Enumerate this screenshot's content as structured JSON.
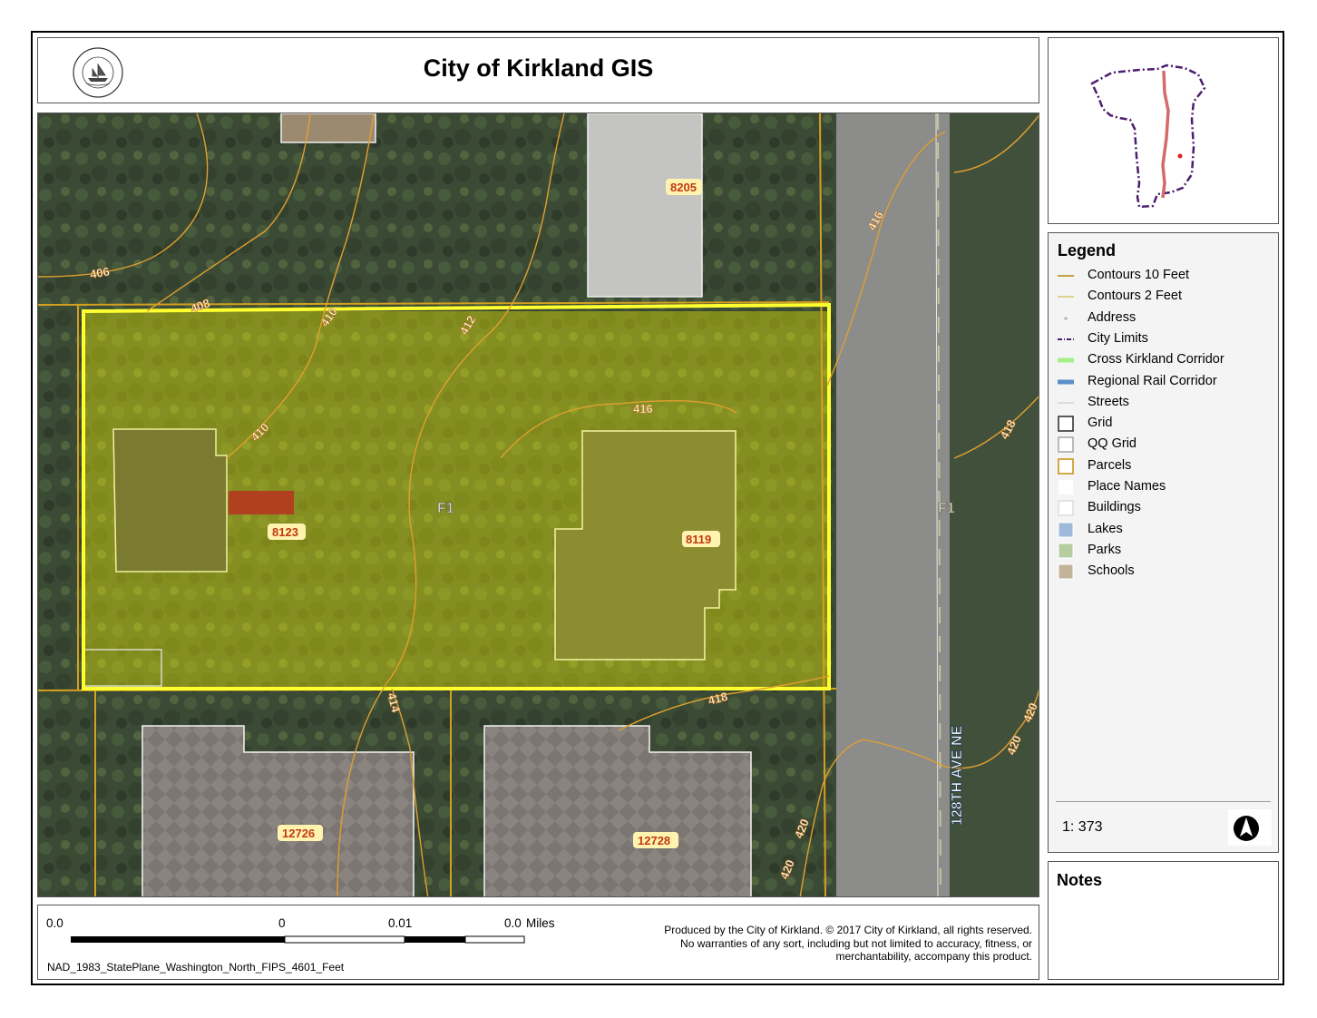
{
  "header": {
    "title": "City of Kirkland GIS"
  },
  "seal": {
    "text_top": "CITY OF KIRKLAND",
    "text_bottom": "WASHINGTON"
  },
  "legend": {
    "title": "Legend",
    "items": [
      {
        "label": "Contours 10 Feet",
        "symbol": "line",
        "color": "#c8a040"
      },
      {
        "label": "Contours 2 Feet",
        "symbol": "line",
        "color": "#e0d090"
      },
      {
        "label": "Address",
        "symbol": "dot",
        "color": "#b0b0b0"
      },
      {
        "label": "City Limits",
        "symbol": "dashdot",
        "color": "#4b1d6e"
      },
      {
        "label": "Cross Kirkland Corridor",
        "symbol": "thick-line",
        "color": "#a6f08c"
      },
      {
        "label": "Regional Rail Corridor",
        "symbol": "thick-line",
        "color": "#5b8fc8"
      },
      {
        "label": "Streets",
        "symbol": "line",
        "color": "#dcdcdc"
      },
      {
        "label": "Grid",
        "symbol": "square",
        "color": "#333333"
      },
      {
        "label": "QQ Grid",
        "symbol": "square",
        "color": "#aaaaaa"
      },
      {
        "label": "Parcels",
        "symbol": "square",
        "color": "#c8941a"
      },
      {
        "label": "Place Names",
        "symbol": "none",
        "color": "#ffffff"
      },
      {
        "label": "Buildings",
        "symbol": "square",
        "color": "#dddddd"
      },
      {
        "label": "Lakes",
        "symbol": "fill",
        "color": "#9eb9d9"
      },
      {
        "label": "Parks",
        "symbol": "fill",
        "color": "#b6cda0"
      },
      {
        "label": "Schools",
        "symbol": "fill",
        "color": "#c2b49a"
      }
    ]
  },
  "scale": {
    "ratio": "1: 373",
    "tick_labels": [
      "0.0",
      "0",
      "0.01",
      "0.0"
    ],
    "units": "Miles",
    "projection": "NAD_1983_StatePlane_Washington_North_FIPS_4601_Feet"
  },
  "credits": [
    "Produced by the City of Kirkland. © 2017 City of Kirkland, all rights reserved.",
    "No warranties of any sort, including but not limited to accuracy, fitness, or",
    "merchantability, accompany this product."
  ],
  "notes": {
    "title": "Notes"
  },
  "map": {
    "addresses": [
      "8205",
      "8123",
      "8119",
      "12726",
      "12728"
    ],
    "contour_labels": [
      "406",
      "408",
      "410",
      "412",
      "410",
      "416",
      "416",
      "418",
      "418",
      "414",
      "420",
      "420",
      "420",
      "420"
    ],
    "grid_labels": [
      "F1",
      "F1"
    ],
    "street_name": "128TH AVE NE",
    "colors": {
      "selection": "#ffff00",
      "parcel": "#d4a020",
      "contour": "#e0a030",
      "building": "#e8e8e8"
    }
  }
}
